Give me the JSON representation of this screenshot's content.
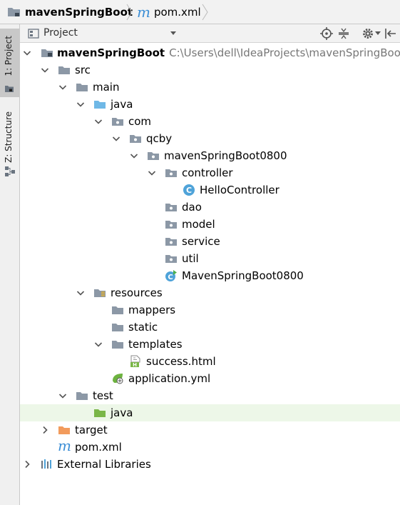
{
  "breadcrumb": {
    "project": "mavenSpringBoot",
    "file_icon": "m",
    "file": "pom.xml"
  },
  "side_tabs": {
    "project": "1: Project",
    "structure": "Z: Structure"
  },
  "panel": {
    "view_mode": "Project",
    "icons": [
      "locate-icon",
      "collapse-all-icon",
      "gear-icon",
      "hide-icon"
    ]
  },
  "tree": {
    "root_name": "mavenSpringBoot",
    "root_path": "C:\\Users\\dell\\IdeaProjects\\mavenSpringBoot",
    "src": "src",
    "main": "main",
    "java": "java",
    "com": "com",
    "qcby": "qcby",
    "pkg": "mavenSpringBoot0800",
    "controller": "controller",
    "hello": "HelloController",
    "class_letter": "C",
    "dao": "dao",
    "model": "model",
    "service": "service",
    "util": "util",
    "app": "MavenSpringBoot0800",
    "resources": "resources",
    "mappers": "mappers",
    "static": "static",
    "templates": "templates",
    "success": "success.html",
    "html_letter": "H",
    "yml": "application.yml",
    "test": "test",
    "test_java": "java",
    "target": "target",
    "pom": "pom.xml",
    "pom_icon": "m",
    "libs": "External Libraries"
  },
  "colors": {
    "folder": "#8c98a6",
    "source_folder": "#6fb8e6",
    "test_folder": "#7ab648",
    "target_folder": "#f29b5c",
    "maven_blue": "#3d8fd6",
    "selection_bg": "#edf7e8"
  }
}
